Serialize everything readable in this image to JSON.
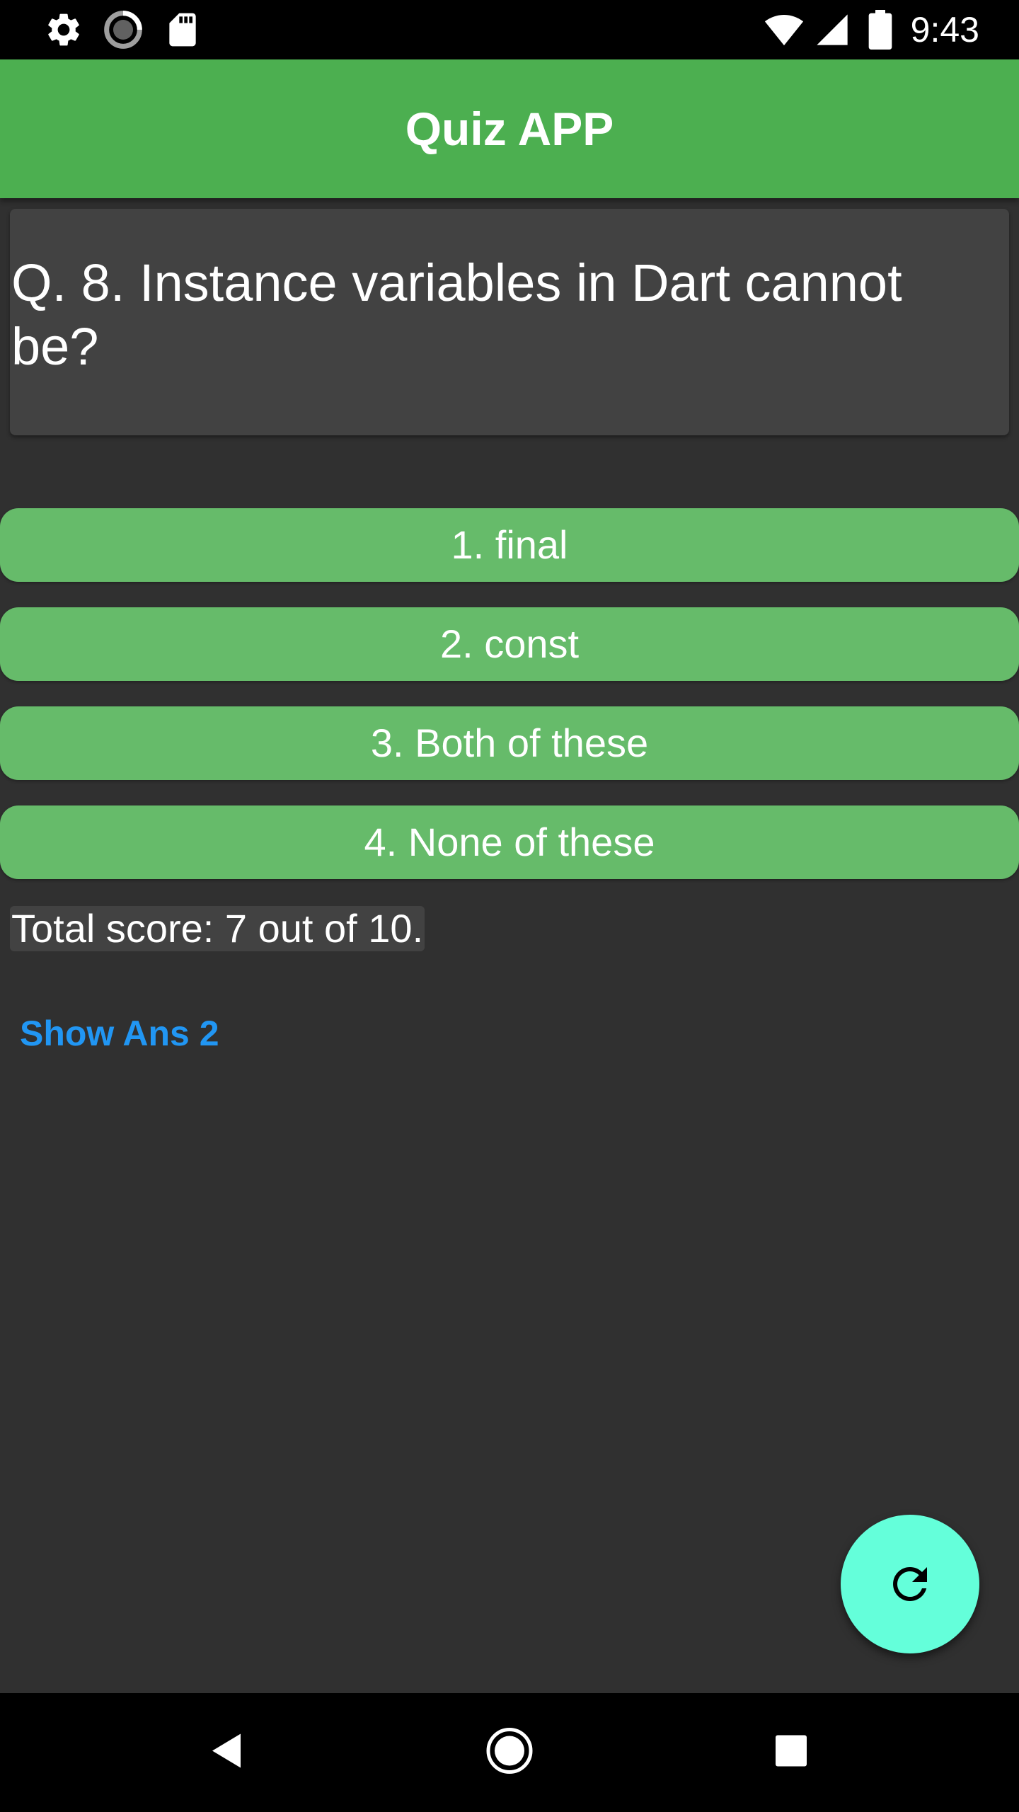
{
  "status_bar": {
    "time": "9:43",
    "icons": [
      "settings-icon",
      "loading-icon",
      "sd-card-icon",
      "wifi-icon",
      "signal-icon",
      "battery-icon"
    ]
  },
  "app_bar": {
    "title": "Quiz APP",
    "color": "#4caf50"
  },
  "question": {
    "text": "Q. 8. Instance variables in Dart cannot be?"
  },
  "options": [
    {
      "label": "1. final"
    },
    {
      "label": "2. const"
    },
    {
      "label": "3. Both of these"
    },
    {
      "label": "4. None of these"
    }
  ],
  "score": {
    "text": "Total score: 7 out of 10."
  },
  "show_answer": {
    "label": "Show Ans 2",
    "color": "#2196f3"
  },
  "fab": {
    "icon": "refresh-icon",
    "color": "#64ffda"
  },
  "nav_bar": {
    "buttons": [
      "back-icon",
      "home-icon",
      "recents-icon"
    ]
  }
}
